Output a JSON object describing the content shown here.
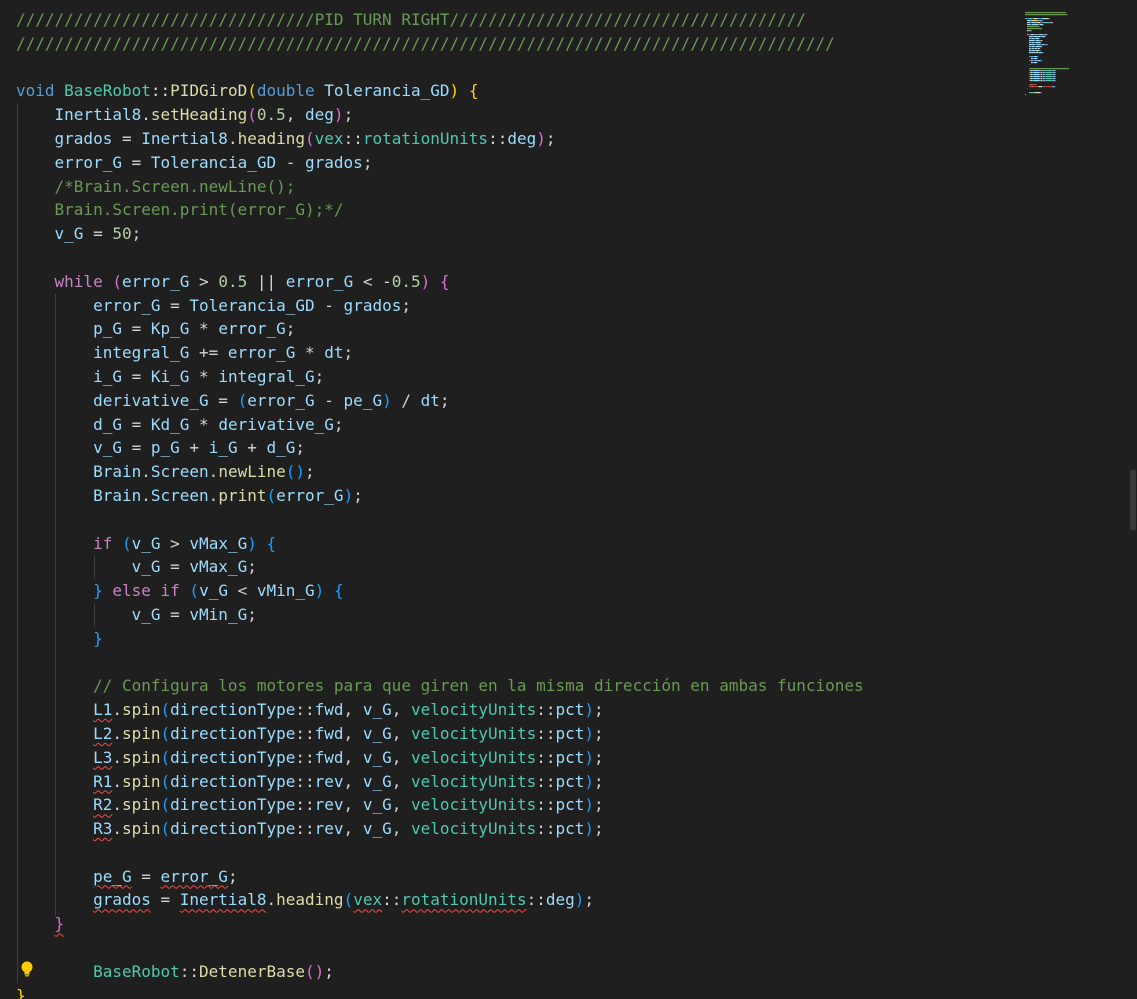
{
  "editor": {
    "language": "C++",
    "theme_colors": {
      "background": "#1f1f1f",
      "keyword": "#569cd6",
      "control": "#c586c0",
      "type": "#4ec9b0",
      "function": "#dcdcaa",
      "variable": "#9cdcfe",
      "number": "#b5cea8",
      "comment": "#6a9955",
      "text": "#cccccc",
      "bracket_1": "#ffd700",
      "bracket_2": "#da70d6",
      "bracket_3": "#179fff",
      "error_squiggle": "#f14c4c"
    },
    "lines": [
      [
        [
          "com",
          "///////////////////////////////PID TURN RIGHT/////////////////////////////////////"
        ]
      ],
      [
        [
          "com",
          "/////////////////////////////////////////////////////////////////////////////////////"
        ]
      ],
      [],
      [
        [
          "kw",
          "void"
        ],
        [
          "op",
          " "
        ],
        [
          "type",
          "BaseRobot"
        ],
        [
          "op",
          ":",
          1
        ],
        [
          "op",
          ":"
        ],
        [
          "fn",
          "PIDGiroD"
        ],
        [
          "p0",
          "("
        ],
        [
          "kw",
          "double"
        ],
        [
          "op",
          " "
        ],
        [
          "var",
          "Tolerancia_GD"
        ],
        [
          "p0",
          ")"
        ],
        [
          "op",
          " "
        ],
        [
          "p0",
          "{"
        ]
      ],
      [
        [
          "op",
          "    "
        ],
        [
          "var",
          "Inertial8"
        ],
        [
          "op",
          "."
        ],
        [
          "fn",
          "setHeading"
        ],
        [
          "p1",
          "("
        ],
        [
          "num",
          "0.5"
        ],
        [
          "op",
          ", "
        ],
        [
          "var",
          "deg"
        ],
        [
          "p1",
          ")"
        ],
        [
          "op",
          ";"
        ]
      ],
      [
        [
          "op",
          "    "
        ],
        [
          "var",
          "grados"
        ],
        [
          "op",
          " = "
        ],
        [
          "var",
          "Inertial8"
        ],
        [
          "op",
          "."
        ],
        [
          "fn",
          "heading"
        ],
        [
          "p1",
          "("
        ],
        [
          "type",
          "vex"
        ],
        [
          "op",
          "::"
        ],
        [
          "type",
          "rotationUnits"
        ],
        [
          "op",
          "::"
        ],
        [
          "var",
          "deg"
        ],
        [
          "p1",
          ")"
        ],
        [
          "op",
          ";"
        ]
      ],
      [
        [
          "op",
          "    "
        ],
        [
          "var",
          "error_G"
        ],
        [
          "op",
          " = "
        ],
        [
          "var",
          "Tolerancia_GD"
        ],
        [
          "op",
          " - "
        ],
        [
          "var",
          "grados"
        ],
        [
          "op",
          ";"
        ]
      ],
      [
        [
          "op",
          "    "
        ],
        [
          "com",
          "/*Brain.Screen.newLine();"
        ]
      ],
      [
        [
          "op",
          "    "
        ],
        [
          "com",
          "Brain.Screen.print(error_G);*/"
        ]
      ],
      [
        [
          "op",
          "    "
        ],
        [
          "var",
          "v_G"
        ],
        [
          "op",
          " = "
        ],
        [
          "num",
          "50"
        ],
        [
          "op",
          ";"
        ]
      ],
      [],
      [
        [
          "op",
          "    "
        ],
        [
          "ctrl",
          "while"
        ],
        [
          "op",
          " "
        ],
        [
          "p1",
          "("
        ],
        [
          "var",
          "error_G"
        ],
        [
          "op",
          " > "
        ],
        [
          "num",
          "0.5"
        ],
        [
          "op",
          " || "
        ],
        [
          "var",
          "error_G"
        ],
        [
          "op",
          " < -"
        ],
        [
          "num",
          "0.5"
        ],
        [
          "p1",
          ")"
        ],
        [
          "op",
          " "
        ],
        [
          "p1",
          "{"
        ]
      ],
      [
        [
          "op",
          "        "
        ],
        [
          "var",
          "error_G"
        ],
        [
          "op",
          " = "
        ],
        [
          "var",
          "Tolerancia_GD"
        ],
        [
          "op",
          " - "
        ],
        [
          "var",
          "grados"
        ],
        [
          "op",
          ";"
        ]
      ],
      [
        [
          "op",
          "        "
        ],
        [
          "var",
          "p_G"
        ],
        [
          "op",
          " = "
        ],
        [
          "var",
          "Kp_G"
        ],
        [
          "op",
          " * "
        ],
        [
          "var",
          "error_G"
        ],
        [
          "op",
          ";"
        ]
      ],
      [
        [
          "op",
          "        "
        ],
        [
          "var",
          "integral_G"
        ],
        [
          "op",
          " += "
        ],
        [
          "var",
          "error_G"
        ],
        [
          "op",
          " * "
        ],
        [
          "var",
          "dt"
        ],
        [
          "op",
          ";"
        ]
      ],
      [
        [
          "op",
          "        "
        ],
        [
          "var",
          "i_G"
        ],
        [
          "op",
          " = "
        ],
        [
          "var",
          "Ki_G"
        ],
        [
          "op",
          " * "
        ],
        [
          "var",
          "integral_G"
        ],
        [
          "op",
          ";"
        ]
      ],
      [
        [
          "op",
          "        "
        ],
        [
          "var",
          "derivative_G"
        ],
        [
          "op",
          " = "
        ],
        [
          "p2",
          "("
        ],
        [
          "var",
          "error_G"
        ],
        [
          "op",
          " - "
        ],
        [
          "var",
          "pe_G"
        ],
        [
          "p2",
          ")"
        ],
        [
          "op",
          " / "
        ],
        [
          "var",
          "dt"
        ],
        [
          "op",
          ";"
        ]
      ],
      [
        [
          "op",
          "        "
        ],
        [
          "var",
          "d_G"
        ],
        [
          "op",
          " = "
        ],
        [
          "var",
          "Kd_G"
        ],
        [
          "op",
          " * "
        ],
        [
          "var",
          "derivative_G"
        ],
        [
          "op",
          ";"
        ]
      ],
      [
        [
          "op",
          "        "
        ],
        [
          "var",
          "v_G"
        ],
        [
          "op",
          " = "
        ],
        [
          "var",
          "p_G"
        ],
        [
          "op",
          " + "
        ],
        [
          "var",
          "i_G"
        ],
        [
          "op",
          " + "
        ],
        [
          "var",
          "d_G"
        ],
        [
          "op",
          ";"
        ]
      ],
      [
        [
          "op",
          "        "
        ],
        [
          "var",
          "Brain"
        ],
        [
          "op",
          "."
        ],
        [
          "var",
          "Screen"
        ],
        [
          "op",
          "."
        ],
        [
          "fn",
          "newLine"
        ],
        [
          "p2",
          "()"
        ],
        [
          "op",
          ";"
        ]
      ],
      [
        [
          "op",
          "        "
        ],
        [
          "var",
          "Brain"
        ],
        [
          "op",
          "."
        ],
        [
          "var",
          "Screen"
        ],
        [
          "op",
          "."
        ],
        [
          "fn",
          "print"
        ],
        [
          "p2",
          "("
        ],
        [
          "var",
          "error_G"
        ],
        [
          "p2",
          ")"
        ],
        [
          "op",
          ";"
        ]
      ],
      [],
      [
        [
          "op",
          "        "
        ],
        [
          "ctrl",
          "if"
        ],
        [
          "op",
          " "
        ],
        [
          "p2",
          "("
        ],
        [
          "var",
          "v_G"
        ],
        [
          "op",
          " > "
        ],
        [
          "var",
          "vMax_G"
        ],
        [
          "p2",
          ")"
        ],
        [
          "op",
          " "
        ],
        [
          "p2",
          "{"
        ]
      ],
      [
        [
          "op",
          "            "
        ],
        [
          "var",
          "v_G"
        ],
        [
          "op",
          " = "
        ],
        [
          "var",
          "vMax_G"
        ],
        [
          "op",
          ";"
        ]
      ],
      [
        [
          "op",
          "        "
        ],
        [
          "p2",
          "}"
        ],
        [
          "op",
          " "
        ],
        [
          "ctrl",
          "else if"
        ],
        [
          "op",
          " "
        ],
        [
          "p2",
          "("
        ],
        [
          "var",
          "v_G"
        ],
        [
          "op",
          " < "
        ],
        [
          "var",
          "vMin_G"
        ],
        [
          "p2",
          ")"
        ],
        [
          "op",
          " "
        ],
        [
          "p2",
          "{"
        ]
      ],
      [
        [
          "op",
          "            "
        ],
        [
          "var",
          "v_G"
        ],
        [
          "op",
          " = "
        ],
        [
          "var",
          "vMin_G"
        ],
        [
          "op",
          ";"
        ]
      ],
      [
        [
          "op",
          "        "
        ],
        [
          "p2",
          "}"
        ]
      ],
      [],
      [
        [
          "op",
          "        "
        ],
        [
          "com",
          "// Configura los motores para que giren en la misma dirección en ambas funciones"
        ]
      ],
      [
        [
          "op",
          "        "
        ],
        [
          "var",
          "L1",
          "e"
        ],
        [
          "op",
          "."
        ],
        [
          "fn",
          "spin"
        ],
        [
          "p2",
          "("
        ],
        [
          "var",
          "directionType"
        ],
        [
          "op",
          "::"
        ],
        [
          "var",
          "fwd"
        ],
        [
          "op",
          ", "
        ],
        [
          "var",
          "v_G"
        ],
        [
          "op",
          ", "
        ],
        [
          "type",
          "velocityUnits"
        ],
        [
          "op",
          "::"
        ],
        [
          "var",
          "pct"
        ],
        [
          "p2",
          ")"
        ],
        [
          "op",
          ";"
        ]
      ],
      [
        [
          "op",
          "        "
        ],
        [
          "var",
          "L2",
          "e"
        ],
        [
          "op",
          "."
        ],
        [
          "fn",
          "spin"
        ],
        [
          "p2",
          "("
        ],
        [
          "var",
          "directionType"
        ],
        [
          "op",
          "::"
        ],
        [
          "var",
          "fwd"
        ],
        [
          "op",
          ", "
        ],
        [
          "var",
          "v_G"
        ],
        [
          "op",
          ", "
        ],
        [
          "type",
          "velocityUnits"
        ],
        [
          "op",
          "::"
        ],
        [
          "var",
          "pct"
        ],
        [
          "p2",
          ")"
        ],
        [
          "op",
          ";"
        ]
      ],
      [
        [
          "op",
          "        "
        ],
        [
          "var",
          "L3",
          "e"
        ],
        [
          "op",
          "."
        ],
        [
          "fn",
          "spin"
        ],
        [
          "p2",
          "("
        ],
        [
          "var",
          "directionType"
        ],
        [
          "op",
          "::"
        ],
        [
          "var",
          "fwd"
        ],
        [
          "op",
          ", "
        ],
        [
          "var",
          "v_G"
        ],
        [
          "op",
          ", "
        ],
        [
          "type",
          "velocityUnits"
        ],
        [
          "op",
          "::"
        ],
        [
          "var",
          "pct"
        ],
        [
          "p2",
          ")"
        ],
        [
          "op",
          ";"
        ]
      ],
      [
        [
          "op",
          "        "
        ],
        [
          "var",
          "R1",
          "e"
        ],
        [
          "op",
          "."
        ],
        [
          "fn",
          "spin"
        ],
        [
          "p2",
          "("
        ],
        [
          "var",
          "directionType"
        ],
        [
          "op",
          "::"
        ],
        [
          "var",
          "rev"
        ],
        [
          "op",
          ", "
        ],
        [
          "var",
          "v_G"
        ],
        [
          "op",
          ", "
        ],
        [
          "type",
          "velocityUnits"
        ],
        [
          "op",
          "::"
        ],
        [
          "var",
          "pct"
        ],
        [
          "p2",
          ")"
        ],
        [
          "op",
          ";"
        ]
      ],
      [
        [
          "op",
          "        "
        ],
        [
          "var",
          "R2",
          "e"
        ],
        [
          "op",
          "."
        ],
        [
          "fn",
          "spin"
        ],
        [
          "p2",
          "("
        ],
        [
          "var",
          "directionType"
        ],
        [
          "op",
          "::"
        ],
        [
          "var",
          "rev"
        ],
        [
          "op",
          ", "
        ],
        [
          "var",
          "v_G"
        ],
        [
          "op",
          ", "
        ],
        [
          "type",
          "velocityUnits"
        ],
        [
          "op",
          "::"
        ],
        [
          "var",
          "pct"
        ],
        [
          "p2",
          ")"
        ],
        [
          "op",
          ";"
        ]
      ],
      [
        [
          "op",
          "        "
        ],
        [
          "var",
          "R3",
          "e"
        ],
        [
          "op",
          "."
        ],
        [
          "fn",
          "spin"
        ],
        [
          "p2",
          "("
        ],
        [
          "var",
          "directionType"
        ],
        [
          "op",
          "::"
        ],
        [
          "var",
          "rev"
        ],
        [
          "op",
          ", "
        ],
        [
          "var",
          "v_G"
        ],
        [
          "op",
          ", "
        ],
        [
          "type",
          "velocityUnits"
        ],
        [
          "op",
          "::"
        ],
        [
          "var",
          "pct"
        ],
        [
          "p2",
          ")"
        ],
        [
          "op",
          ";"
        ]
      ],
      [],
      [
        [
          "op",
          "        "
        ],
        [
          "var",
          "pe_G",
          "e"
        ],
        [
          "op",
          " = "
        ],
        [
          "var",
          "error_G",
          "e"
        ],
        [
          "op",
          ";"
        ]
      ],
      [
        [
          "op",
          "        "
        ],
        [
          "var",
          "grados",
          "e"
        ],
        [
          "op",
          " = "
        ],
        [
          "var",
          "Inertial8",
          "e"
        ],
        [
          "op",
          "."
        ],
        [
          "fn",
          "heading"
        ],
        [
          "p2",
          "("
        ],
        [
          "type",
          "vex",
          "e"
        ],
        [
          "op",
          "::"
        ],
        [
          "type",
          "rotationUnits",
          "e"
        ],
        [
          "op",
          "::"
        ],
        [
          "var",
          "deg"
        ],
        [
          "p2",
          ")"
        ],
        [
          "op",
          ";"
        ]
      ],
      [
        [
          "op",
          "    "
        ],
        [
          "p1",
          "}",
          "e"
        ]
      ],
      [],
      [
        [
          "op",
          "        "
        ],
        [
          "type",
          "BaseRobot"
        ],
        [
          "op",
          "::"
        ],
        [
          "fn",
          "DetenerBase"
        ],
        [
          "p1",
          "()"
        ],
        [
          "op",
          ";"
        ]
      ],
      [
        [
          "p0",
          "}"
        ]
      ]
    ]
  },
  "icons": {
    "lightbulb": "lightbulb-icon",
    "minimap": "minimap"
  }
}
